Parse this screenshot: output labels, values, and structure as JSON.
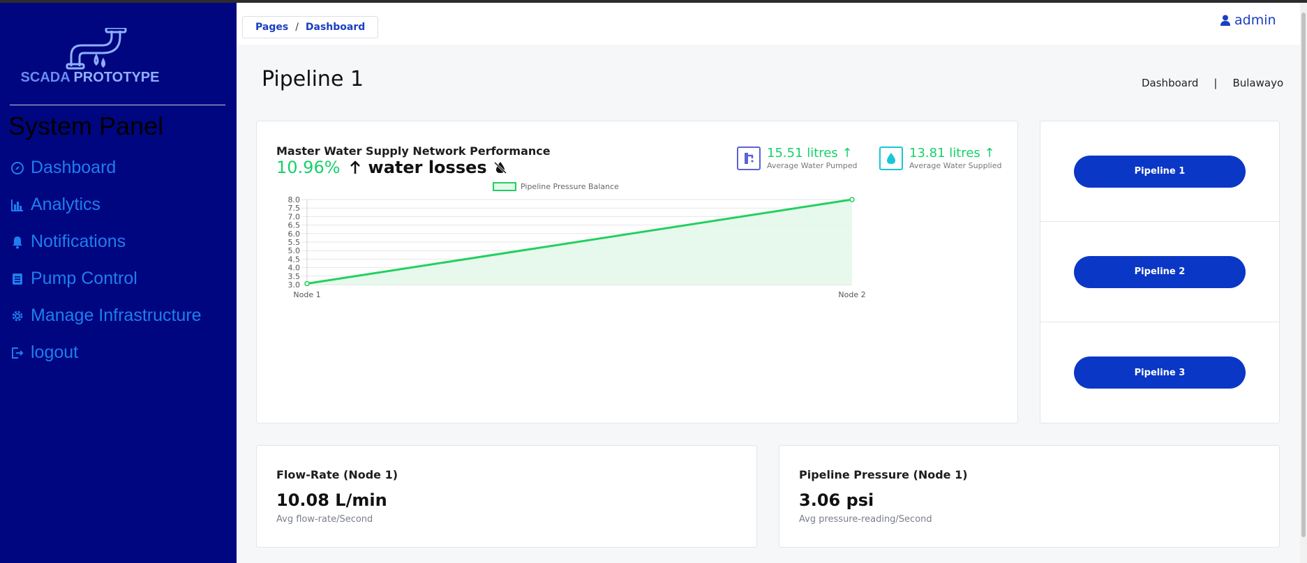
{
  "brand": {
    "name_part1": "SCADA ",
    "name_part2": "PROTOTYPE"
  },
  "sidebar": {
    "panel_title": "System Panel",
    "items": [
      {
        "label": "Dashboard",
        "icon": "compass-icon"
      },
      {
        "label": "Analytics",
        "icon": "bar-chart-icon"
      },
      {
        "label": "Notifications",
        "icon": "bell-icon"
      },
      {
        "label": "Pump Control",
        "icon": "list-icon"
      },
      {
        "label": "Manage Infrastructure",
        "icon": "gear-icon"
      },
      {
        "label": "logout",
        "icon": "logout-icon"
      }
    ]
  },
  "header": {
    "breadcrumb": [
      "Pages",
      "Dashboard"
    ],
    "breadcrumb_sep": "/",
    "user": "admin"
  },
  "page": {
    "title": "Pipeline 1",
    "crumb_right": [
      "Dashboard",
      "Bulawayo"
    ],
    "crumb_sep": "|"
  },
  "performance": {
    "title": "Master Water Supply Network Performance",
    "percent": "10.96%",
    "label": "water losses",
    "stats": [
      {
        "value": "15.51 litres",
        "label": "Average Water Pumped",
        "icon": "tap-icon",
        "color": "#5a62d8"
      },
      {
        "value": "13.81 litres",
        "label": "Average Water Supplied",
        "icon": "droplet-icon",
        "color": "#17c6d8"
      }
    ]
  },
  "chart_data": {
    "type": "area",
    "legend": [
      "Pipeline Pressure Balance"
    ],
    "legend_placement": "top-center",
    "categories": [
      "Node 1",
      "Node 2"
    ],
    "series": [
      {
        "name": "Pipeline Pressure Balance",
        "values": [
          3.06,
          8.0
        ]
      }
    ],
    "ylim": [
      3.0,
      8.0
    ],
    "yticks": [
      "8.0",
      "7.5",
      "7.0",
      "6.5",
      "6.0",
      "5.5",
      "5.0",
      "4.5",
      "4.0",
      "3.5",
      "3.0"
    ],
    "grid": true,
    "line_color": "#22d05f",
    "fill_color": "#e3f8ea"
  },
  "pipelines": [
    "Pipeline 1",
    "Pipeline 2",
    "Pipeline 3"
  ],
  "cards": [
    {
      "title": "Flow-Rate (Node 1)",
      "value": "10.08 L/min",
      "sub": "Avg flow-rate/Second"
    },
    {
      "title": "Pipeline Pressure (Node 1)",
      "value": "3.06 psi",
      "sub": "Avg pressure-reading/Second"
    }
  ]
}
